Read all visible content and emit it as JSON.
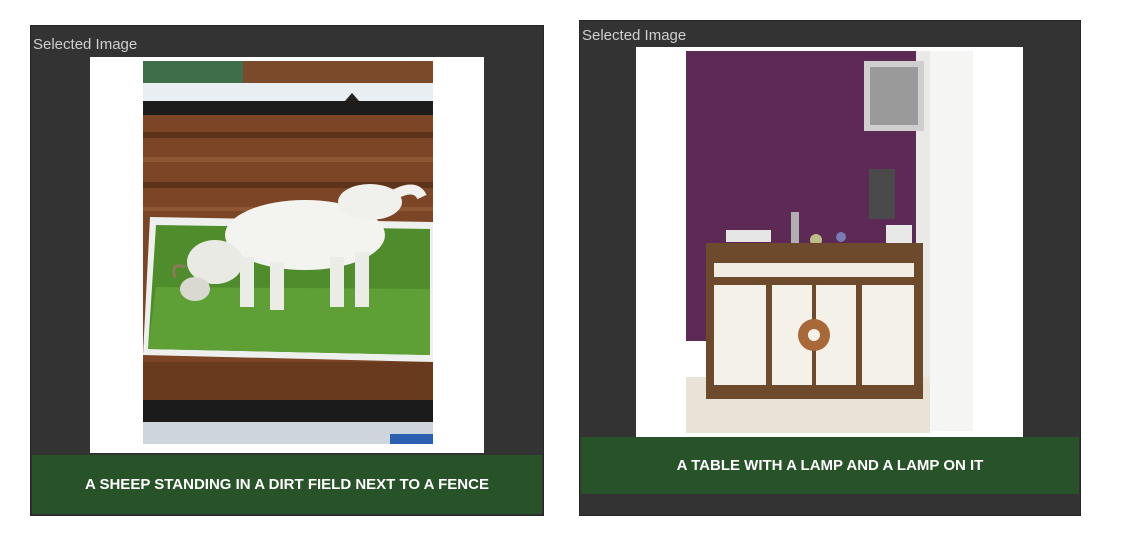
{
  "panels": [
    {
      "title": "Selected Image",
      "image_subject": "goat-grazing-photo",
      "caption": "A SHEEP STANDING IN A DIRT FIELD NEXT TO A FENCE"
    },
    {
      "title": "Selected Image",
      "image_subject": "purple-wall-sideboard-photo",
      "caption": "A TABLE WITH A LAMP AND A LAMP ON IT"
    }
  ],
  "colors": {
    "panel_bg": "#333333",
    "caption_bg": "#285228",
    "caption_text": "#ffffff",
    "title_text": "#d0d0d0",
    "wall_purple": "#5c2a55"
  }
}
